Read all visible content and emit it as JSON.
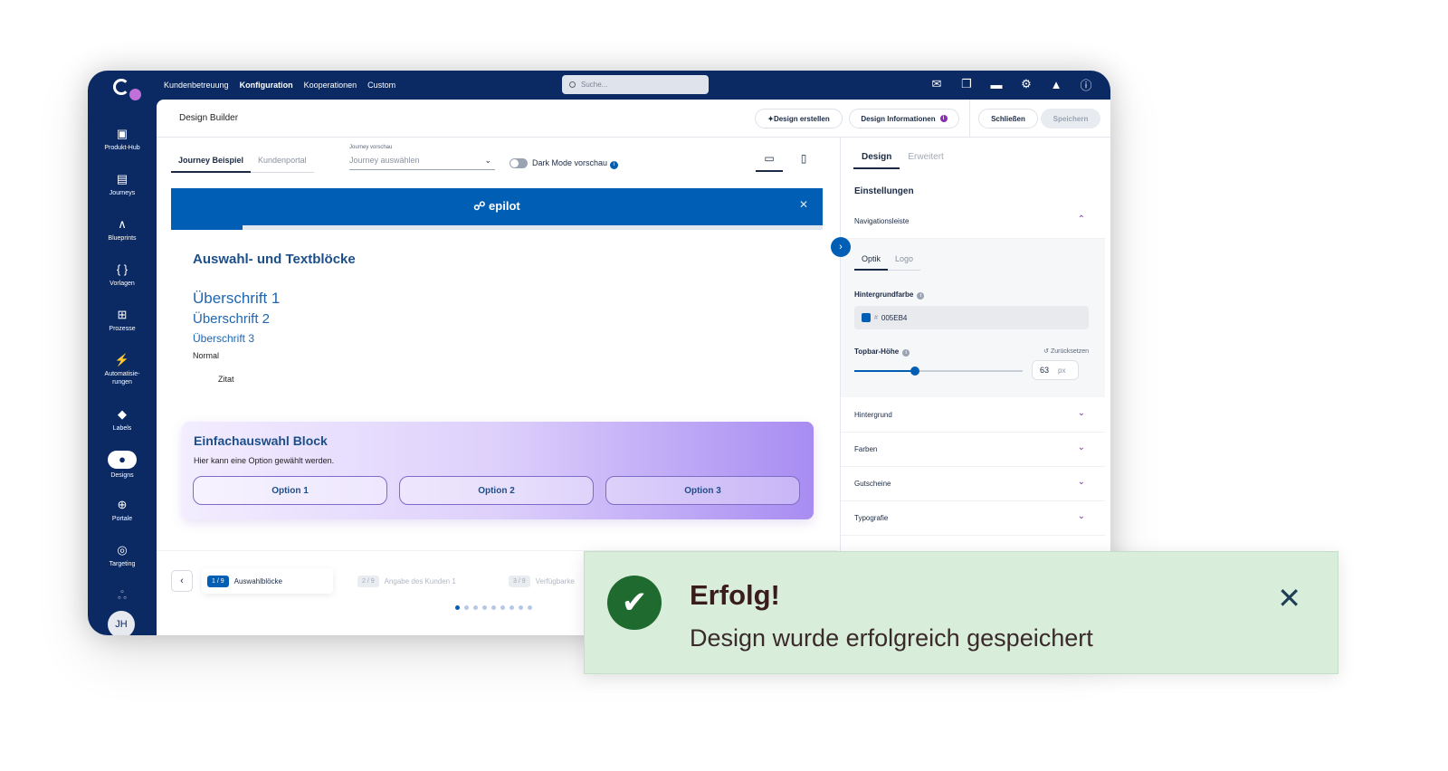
{
  "topnav": {
    "items": [
      "Kundenbetreuung",
      "Konfiguration",
      "Kooperationen",
      "Custom"
    ],
    "active": "Konfiguration",
    "search_placeholder": "Suche..."
  },
  "sidebar": {
    "items": [
      {
        "label": "Produkt-Hub",
        "icon": "cube-icon"
      },
      {
        "label": "Journeys",
        "icon": "journey-icon"
      },
      {
        "label": "Blueprints",
        "icon": "compass-icon"
      },
      {
        "label": "Vorlagen",
        "icon": "braces-icon"
      },
      {
        "label": "Prozesse",
        "icon": "flow-icon"
      },
      {
        "label": "Automatisie-\nrungen",
        "icon": "bolt-icon"
      },
      {
        "label": "Labels",
        "icon": "tag-icon"
      },
      {
        "label": "Designs",
        "icon": "palette-icon"
      },
      {
        "label": "Portale",
        "icon": "globe-icon"
      },
      {
        "label": "Targeting",
        "icon": "target-icon"
      }
    ],
    "avatar_initials": "JH"
  },
  "header": {
    "title": "Design Builder",
    "create_label": "Design erstellen",
    "info_label": "Design Informationen",
    "close_label": "Schließen",
    "save_label": "Speichern"
  },
  "preview": {
    "tabs": [
      "Journey Beispiel",
      "Kundenportal"
    ],
    "journey_label": "Journey vorschau",
    "journey_placeholder": "Journey auswählen",
    "darkmode_label": "Dark Mode vorschau",
    "brand": "epilot",
    "progress": 0.11,
    "section_title": "Auswahl- und Textblöcke",
    "heading1": "Überschrift 1",
    "heading2": "Überschrift 2",
    "heading3": "Überschrift 3",
    "normal": "Normal",
    "quote": "Zitat",
    "choice_title": "Einfachauswahl Block",
    "choice_sub": "Hier kann eine Option gewählt werden.",
    "options": [
      "Option 1",
      "Option 2",
      "Option 3"
    ]
  },
  "stepper": {
    "steps": [
      {
        "num": "1 / 9",
        "label": "Auswahlblöcke"
      },
      {
        "num": "2 / 9",
        "label": "Angabe des Kunden 1"
      },
      {
        "num": "3 / 9",
        "label": "Verfügbarke"
      }
    ]
  },
  "settings": {
    "tabs": [
      "Design",
      "Erweitert"
    ],
    "section": "Einstellungen",
    "nav_label": "Navigationsleiste",
    "subtabs": [
      "Optik",
      "Logo"
    ],
    "bg_color_label": "Hintergrundfarbe",
    "hash": "#",
    "bg_color_value": "005EB4",
    "topbar_label": "Topbar-Höhe",
    "reset_label": "Zurücksetzen",
    "topbar_value": "63",
    "topbar_unit": "px",
    "slider_fraction": 0.36,
    "accordions": [
      "Hintergrund",
      "Farben",
      "Gutscheine",
      "Typografie"
    ]
  },
  "toast": {
    "title": "Erfolg!",
    "message": "Design wurde erfolgreich gespeichert"
  },
  "colors": {
    "brand_blue": "#005EB4",
    "navy": "#0B2A63",
    "success_bg": "#D9EDDB",
    "success_icon": "#1F6A2E"
  }
}
